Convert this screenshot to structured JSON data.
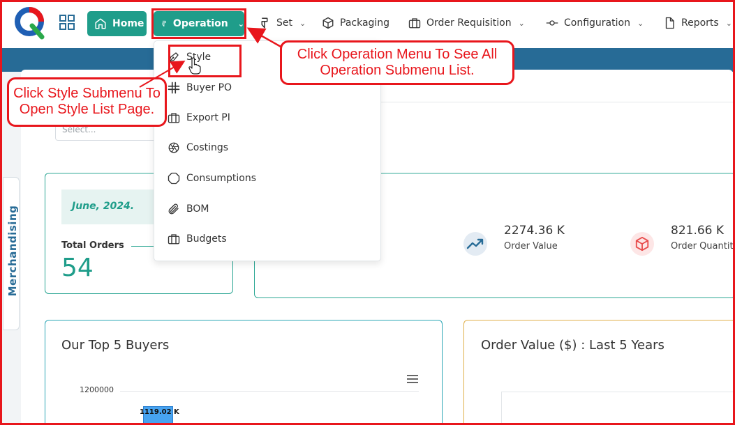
{
  "nav": {
    "home_label": "Home",
    "operation_label": "Operation",
    "set_label": "Set",
    "packaging_label": "Packaging",
    "order_requisition_label": "Order Requisition",
    "configuration_label": "Configuration",
    "reports_label": "Reports"
  },
  "operation_menu": {
    "items": [
      {
        "label": "Style",
        "icon": "pen-tool-icon"
      },
      {
        "label": "Buyer PO",
        "icon": "slack-icon"
      },
      {
        "label": "Export PI",
        "icon": "briefcase-icon"
      },
      {
        "label": "Costings",
        "icon": "aperture-icon"
      },
      {
        "label": "Consumptions",
        "icon": "octagon-icon"
      },
      {
        "label": "BOM",
        "icon": "paperclip-icon"
      },
      {
        "label": "Budgets",
        "icon": "briefcase-icon"
      }
    ]
  },
  "callouts": {
    "operation_line1": "Click Operation Menu To See All",
    "operation_line2": "Operation Submenu List.",
    "style_line1": "Click Style Submenu To",
    "style_line2": "Open Style List Page."
  },
  "filters": {
    "select_placeholder": "Select..."
  },
  "sidebar": {
    "tab_label": "Merchandising"
  },
  "summary": {
    "date": "June, 2024.",
    "total_orders_label": "Total Orders",
    "total_orders_value": "54",
    "order_value": "2274.36 K",
    "order_value_label": "Order Value",
    "order_quantity": "821.66 K",
    "order_quantity_label": "Order Quantity"
  },
  "top_buyers_chart": {
    "title": "Our Top 5 Buyers",
    "tick_label": "1200000",
    "bar_label": "1119.02 K"
  },
  "order_value_chart": {
    "title": "Order Value ($) : Last 5 Years"
  },
  "colors": {
    "accent_green": "#1f9d8a",
    "banner_blue": "#276b96",
    "annotation_red": "#e8161c",
    "bar_blue": "#47a3f0"
  }
}
